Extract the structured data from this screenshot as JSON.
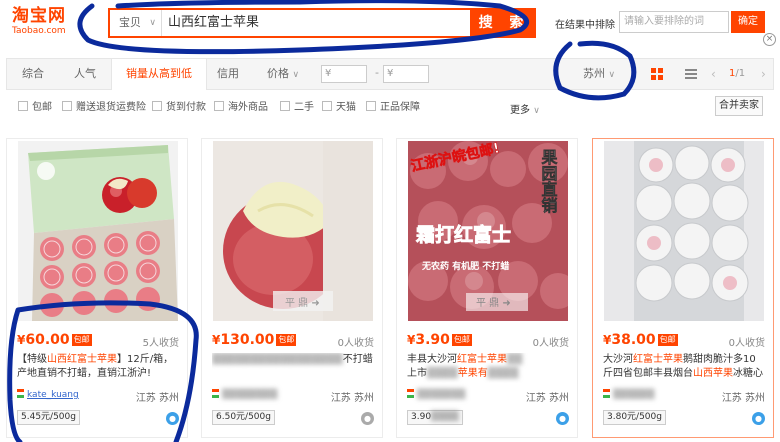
{
  "header": {
    "logo_cn": "淘宝网",
    "logo_en": "Taobao.com",
    "scope_label": "宝贝",
    "search_query": "山西红富士苹果",
    "search_button": "搜 索",
    "exclude_label": "在结果中排除",
    "exclude_placeholder": "请输入要排除的词",
    "ok_button": "确定",
    "close_glyph": "×"
  },
  "sortbar": {
    "items": [
      "综合",
      "人气",
      "销量从高到低",
      "信用",
      "价格"
    ],
    "active_index": 2,
    "price_from_placeholder": "¥",
    "price_to_placeholder": "¥",
    "dash": "-",
    "location": "苏州",
    "page_current": "1",
    "page_total": "/1"
  },
  "filters": {
    "items": [
      "包邮",
      "赠送退货运费险",
      "货到付款",
      "海外商品",
      "二手",
      "天猫",
      "正品保障"
    ],
    "more": "更多",
    "merge_sellers": "合并卖家"
  },
  "products": [
    {
      "price": "60.00",
      "free_ship": "包邮",
      "sold": "5人收货",
      "title_parts": [
        "【特级",
        "山西红富士苹果",
        "】12斤/箱，产地直销不打蜡，直销江浙沪!"
      ],
      "shop": "kate_kuang",
      "location": "江苏 苏州",
      "unit_price": "5.45元/500g"
    },
    {
      "price": "130.00",
      "free_ship": "包邮",
      "sold": "0人收货",
      "title_parts": [
        "",
        "",
        "不打蜡"
      ],
      "shop": "",
      "location": "江苏 苏州",
      "unit_price": "6.50元/500g"
    },
    {
      "price": "3.90",
      "free_ship": "包邮",
      "sold": "0人收货",
      "title_parts": [
        "丰县大沙河",
        "红富士苹果",
        "上市"
      ],
      "title_tail": "苹果有",
      "shop": "",
      "location": "江苏 苏州",
      "unit_price": "3.90"
    },
    {
      "price": "38.00",
      "free_ship": "包邮",
      "sold": "0人收货",
      "title_parts": [
        "大沙河",
        "红富士苹果",
        "鹅甜肉脆汁多10斤四省包邮丰县烟台",
        "山西苹果",
        "冰糖心"
      ],
      "shop": "",
      "location": "江苏 苏州",
      "unit_price": "3.80元/500g"
    }
  ],
  "image_text": {
    "p3_banner": "江浙沪皖包邮!",
    "p3_side": "果园直销",
    "p3_main": "霜打红富士",
    "p3_sub": "无农药 有机肥 不打蜡",
    "p2_watermark": "平 鼎 ➜",
    "p3_watermark": "平 鼎 ➜"
  },
  "colors": {
    "accent": "#ff4400",
    "marker": "#0b2a9c",
    "link": "#3366cc"
  }
}
